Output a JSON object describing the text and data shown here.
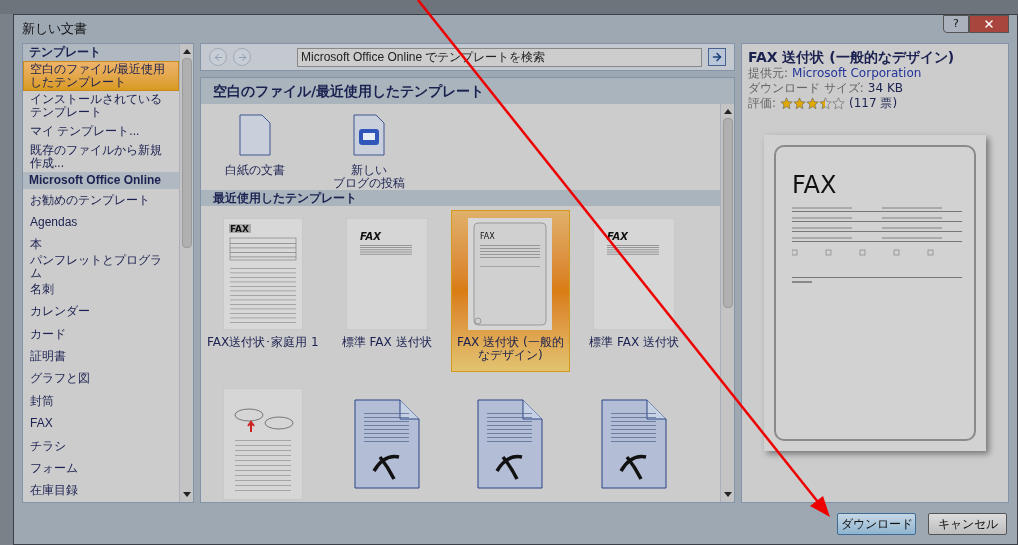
{
  "window": {
    "title": "新しい文書",
    "help": "?"
  },
  "sidebar": {
    "items": [
      {
        "kind": "header",
        "label": "テンプレート"
      },
      {
        "kind": "item",
        "label": "空白のファイル/最近使用したテンプレート",
        "selected": true
      },
      {
        "kind": "item",
        "label": "インストールされているテンプレート",
        "selected": false
      },
      {
        "kind": "item",
        "label": "マイ テンプレート...",
        "selected": false
      },
      {
        "kind": "item",
        "label": "既存のファイルから新規作成...",
        "selected": false
      },
      {
        "kind": "header",
        "label": "Microsoft Office Online"
      },
      {
        "kind": "item",
        "label": "お勧めのテンプレート",
        "selected": false
      },
      {
        "kind": "item",
        "label": "Agendas",
        "selected": false
      },
      {
        "kind": "item",
        "label": "本",
        "selected": false
      },
      {
        "kind": "item",
        "label": "パンフレットとプログラム",
        "selected": false
      },
      {
        "kind": "item",
        "label": "名刺",
        "selected": false
      },
      {
        "kind": "item",
        "label": "カレンダー",
        "selected": false
      },
      {
        "kind": "item",
        "label": "カード",
        "selected": false
      },
      {
        "kind": "item",
        "label": "証明書",
        "selected": false
      },
      {
        "kind": "item",
        "label": "グラフと図",
        "selected": false
      },
      {
        "kind": "item",
        "label": "封筒",
        "selected": false
      },
      {
        "kind": "item",
        "label": "FAX",
        "selected": false
      },
      {
        "kind": "item",
        "label": "チラシ",
        "selected": false
      },
      {
        "kind": "item",
        "label": "フォーム",
        "selected": false
      },
      {
        "kind": "item",
        "label": "在庫目録",
        "selected": false
      }
    ]
  },
  "search": {
    "placeholder": "Microsoft Office Online でテンプレートを検索"
  },
  "content": {
    "title": "空白のファイル/最近使用したテンプレート",
    "blank_items": [
      {
        "kind": "blank",
        "label_lines": [
          "白紙の文書"
        ]
      },
      {
        "kind": "blog",
        "label_lines": [
          "新しい",
          "ブログの投稿"
        ]
      }
    ],
    "recent_title": "最近使用したテンプレート",
    "templates": [
      {
        "kind": "form",
        "thumb_title": "FAX",
        "label": "FAX送付状･家庭用 1",
        "selected": false
      },
      {
        "kind": "letter",
        "thumb_title": "FAX",
        "label": "標準 FAX 送付状",
        "selected": false
      },
      {
        "kind": "rounded",
        "thumb_title": "FAX",
        "label": "FAX 送付状 (一般的なデザイン)",
        "selected": true
      },
      {
        "kind": "letter",
        "thumb_title": "FAX",
        "label": "標準 FAX 送付状",
        "selected": false
      },
      {
        "kind": "memo",
        "selected": false
      },
      {
        "kind": "word",
        "selected": false
      },
      {
        "kind": "word",
        "selected": false
      },
      {
        "kind": "word",
        "selected": false
      }
    ]
  },
  "details": {
    "title": "FAX 送付状 (一般的なデザイン)",
    "provider_label": "提供元:",
    "provider": "Microsoft Corporation",
    "size_label": "ダウンロード サイズ:",
    "size": "34 KB",
    "rating_label": "評価:",
    "stars": 3.5,
    "votes": "(117 票)",
    "preview_title": "FAX"
  },
  "buttons": [
    {
      "kind": "primary",
      "label": "ダウンロード"
    },
    {
      "kind": "default",
      "label": "キャンセル"
    }
  ]
}
